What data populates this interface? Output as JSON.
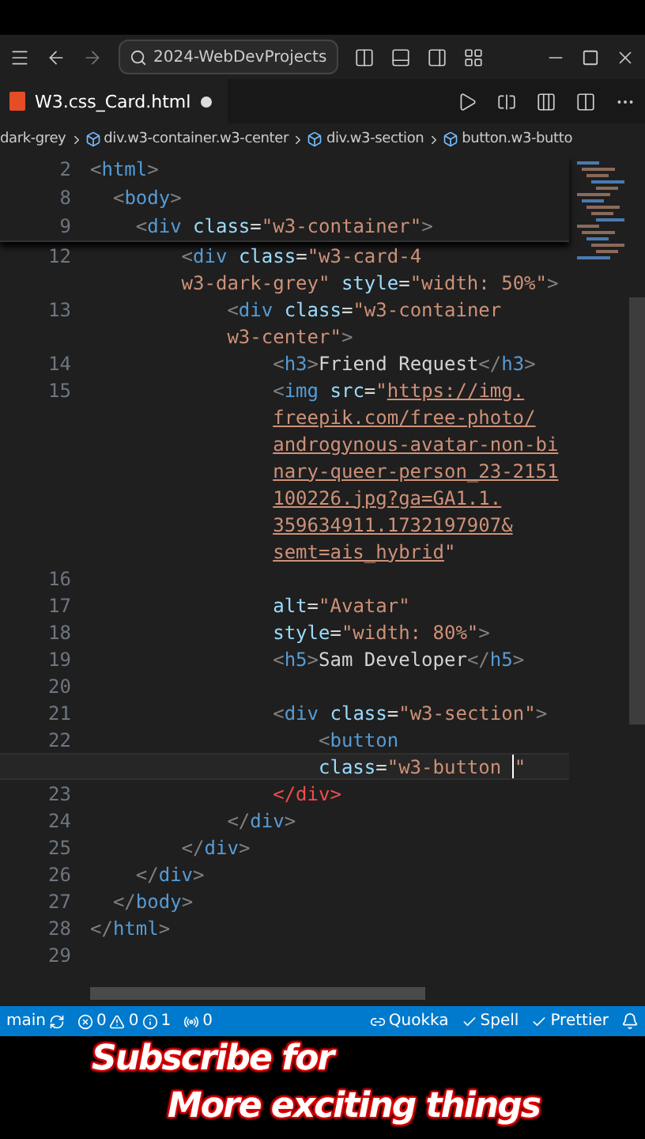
{
  "title_bar": {
    "search": "2024-WebDevProjects"
  },
  "tab": {
    "label": "W3.css_Card.html",
    "modified": true
  },
  "breadcrumbs": [
    "dark-grey",
    "div.w3-container.w3-center",
    "div.w3-section",
    "button.w3-butto"
  ],
  "sticky_lines": [
    {
      "number": "2",
      "tokens": [
        {
          "kind": "p",
          "text": "<"
        },
        {
          "kind": "tag",
          "text": "html"
        },
        {
          "kind": "p",
          "text": ">"
        }
      ]
    },
    {
      "number": "8",
      "tokens": [
        {
          "kind": "p",
          "text": "  <"
        },
        {
          "kind": "tag",
          "text": "body"
        },
        {
          "kind": "p",
          "text": ">"
        }
      ]
    },
    {
      "number": "9",
      "tokens": [
        {
          "kind": "p",
          "text": "    <"
        },
        {
          "kind": "tag",
          "text": "div"
        },
        {
          "kind": "attr",
          "text": " class"
        },
        {
          "kind": "text",
          "text": "="
        },
        {
          "kind": "str",
          "text": "\"w3-container\""
        },
        {
          "kind": "p",
          "text": ">"
        }
      ]
    }
  ],
  "lines": [
    {
      "number": "12",
      "tokens": [
        {
          "kind": "p",
          "text": "        <"
        },
        {
          "kind": "tag",
          "text": "div"
        },
        {
          "kind": "attr",
          "text": " class"
        },
        {
          "kind": "text",
          "text": "="
        },
        {
          "kind": "str",
          "text": "\"w3-card-4"
        }
      ]
    },
    {
      "tokens": [
        {
          "kind": "str",
          "text": "        w3-dark-grey\""
        },
        {
          "kind": "attr",
          "text": " style"
        },
        {
          "kind": "text",
          "text": "="
        },
        {
          "kind": "str",
          "text": "\"width: 50%\""
        },
        {
          "kind": "p",
          "text": ">"
        }
      ]
    },
    {
      "number": "13",
      "tokens": [
        {
          "kind": "p",
          "text": "            <"
        },
        {
          "kind": "tag",
          "text": "div"
        },
        {
          "kind": "attr",
          "text": " class"
        },
        {
          "kind": "text",
          "text": "="
        },
        {
          "kind": "str",
          "text": "\"w3-container"
        }
      ]
    },
    {
      "tokens": [
        {
          "kind": "str",
          "text": "            w3-center\""
        },
        {
          "kind": "p",
          "text": ">"
        }
      ]
    },
    {
      "number": "14",
      "tokens": [
        {
          "kind": "p",
          "text": "                <"
        },
        {
          "kind": "tag",
          "text": "h3"
        },
        {
          "kind": "p",
          "text": ">"
        },
        {
          "kind": "text",
          "text": "Friend Request"
        },
        {
          "kind": "p",
          "text": "</"
        },
        {
          "kind": "tag",
          "text": "h3"
        },
        {
          "kind": "p",
          "text": ">"
        }
      ]
    },
    {
      "number": "15",
      "tokens": [
        {
          "kind": "p",
          "text": "                <"
        },
        {
          "kind": "tag",
          "text": "img"
        },
        {
          "kind": "attr",
          "text": " src"
        },
        {
          "kind": "text",
          "text": "="
        },
        {
          "kind": "str",
          "text": "\""
        },
        {
          "kind": "link",
          "text": "https://img."
        }
      ]
    },
    {
      "tokens": [
        {
          "kind": "link",
          "text": "                freepik.com/free-photo/"
        }
      ]
    },
    {
      "tokens": [
        {
          "kind": "link",
          "text": "                androgynous-avatar-non-bi"
        }
      ]
    },
    {
      "tokens": [
        {
          "kind": "link",
          "text": "                nary-queer-person_23-2151"
        }
      ]
    },
    {
      "tokens": [
        {
          "kind": "link",
          "text": "                100226.jpg?ga=GA1.1."
        }
      ]
    },
    {
      "tokens": [
        {
          "kind": "link",
          "text": "                359634911.1732197907&"
        }
      ]
    },
    {
      "tokens": [
        {
          "kind": "link",
          "text": "                semt=ais_hybrid"
        },
        {
          "kind": "str",
          "text": "\""
        }
      ]
    },
    {
      "number": "16"
    },
    {
      "number": "17",
      "tokens": [
        {
          "kind": "attr",
          "text": "                alt"
        },
        {
          "kind": "text",
          "text": "="
        },
        {
          "kind": "str",
          "text": "\"Avatar\""
        }
      ]
    },
    {
      "number": "18",
      "tokens": [
        {
          "kind": "attr",
          "text": "                style"
        },
        {
          "kind": "text",
          "text": "="
        },
        {
          "kind": "str",
          "text": "\"width: 80%\""
        },
        {
          "kind": "p",
          "text": ">"
        }
      ]
    },
    {
      "number": "19",
      "tokens": [
        {
          "kind": "p",
          "text": "                <"
        },
        {
          "kind": "tag",
          "text": "h5"
        },
        {
          "kind": "p",
          "text": ">"
        },
        {
          "kind": "text",
          "text": "Sam Developer"
        },
        {
          "kind": "p",
          "text": "</"
        },
        {
          "kind": "tag",
          "text": "h5"
        },
        {
          "kind": "p",
          "text": ">"
        }
      ]
    },
    {
      "number": "20"
    },
    {
      "number": "21",
      "tokens": [
        {
          "kind": "p",
          "text": "                <"
        },
        {
          "kind": "tag",
          "text": "div"
        },
        {
          "kind": "attr",
          "text": " class"
        },
        {
          "kind": "text",
          "text": "="
        },
        {
          "kind": "str",
          "text": "\"w3-section\""
        },
        {
          "kind": "p",
          "text": ">"
        }
      ]
    },
    {
      "number": "22",
      "tokens": [
        {
          "kind": "p",
          "text": "                    <"
        },
        {
          "kind": "tag",
          "text": "button"
        }
      ]
    },
    {
      "current": true,
      "tokens": [
        {
          "kind": "attr",
          "text": "                    class"
        },
        {
          "kind": "text",
          "text": "="
        },
        {
          "kind": "str",
          "text": "\"w3-button "
        },
        {
          "kind": "cursor"
        },
        {
          "kind": "str",
          "text": "\""
        }
      ]
    },
    {
      "number": "23",
      "tokens": [
        {
          "kind": "err",
          "text": "                </div>"
        }
      ]
    },
    {
      "number": "24",
      "tokens": [
        {
          "kind": "p",
          "text": "            </"
        },
        {
          "kind": "tag",
          "text": "div"
        },
        {
          "kind": "p",
          "text": ">"
        }
      ]
    },
    {
      "number": "25",
      "tokens": [
        {
          "kind": "p",
          "text": "        </"
        },
        {
          "kind": "tag",
          "text": "div"
        },
        {
          "kind": "p",
          "text": ">"
        }
      ]
    },
    {
      "number": "26",
      "tokens": [
        {
          "kind": "p",
          "text": "    </"
        },
        {
          "kind": "tag",
          "text": "div"
        },
        {
          "kind": "p",
          "text": ">"
        }
      ]
    },
    {
      "number": "27",
      "tokens": [
        {
          "kind": "p",
          "text": "  </"
        },
        {
          "kind": "tag",
          "text": "body"
        },
        {
          "kind": "p",
          "text": ">"
        }
      ]
    },
    {
      "number": "28",
      "tokens": [
        {
          "kind": "p",
          "text": "</"
        },
        {
          "kind": "tag",
          "text": "html"
        },
        {
          "kind": "p",
          "text": ">"
        }
      ]
    },
    {
      "number": "29"
    }
  ],
  "status_bar": {
    "branch": "main",
    "errors": "0",
    "warnings": "0",
    "infos": "1",
    "ports": "0",
    "right": [
      "Quokka",
      "Spell",
      "Prettier"
    ]
  },
  "caption": [
    "Subscribe for",
    "More exciting things"
  ]
}
